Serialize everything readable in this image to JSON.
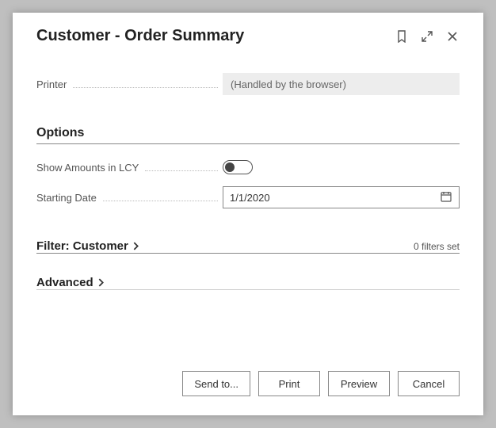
{
  "title": "Customer - Order Summary",
  "fields": {
    "printer": {
      "label": "Printer",
      "value": "(Handled by the browser)"
    }
  },
  "options": {
    "header": "Options",
    "show_amounts_lcy": {
      "label": "Show Amounts in LCY",
      "value": false
    },
    "starting_date": {
      "label": "Starting Date",
      "value": "1/1/2020"
    }
  },
  "filter": {
    "header": "Filter: Customer",
    "count_text": "0 filters set"
  },
  "advanced": {
    "header": "Advanced"
  },
  "buttons": {
    "send_to": "Send to...",
    "print": "Print",
    "preview": "Preview",
    "cancel": "Cancel"
  }
}
